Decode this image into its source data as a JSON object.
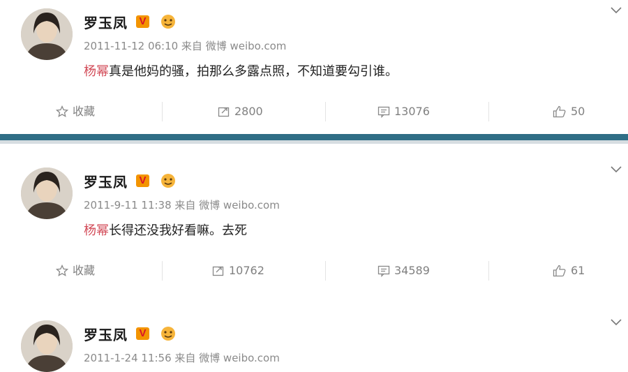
{
  "posts": [
    {
      "username": "罗玉凤",
      "verified_badge": "V",
      "emoji_badge": "smiling-face-icon",
      "meta": "2011-11-12 06:10 来自 微博 weibo.com",
      "mention": "杨幂",
      "text": "真是他妈的骚，拍那么多露点照，不知道要勾引谁。",
      "actions": {
        "favorite": "收藏",
        "repost": "2800",
        "comment": "13076",
        "like": "50"
      }
    },
    {
      "username": "罗玉凤",
      "verified_badge": "V",
      "emoji_badge": "smiling-face-icon",
      "meta": "2011-9-11 11:38 来自 微博 weibo.com",
      "mention": "杨幂",
      "text": "长得还没我好看嘛。去死",
      "actions": {
        "favorite": "收藏",
        "repost": "10762",
        "comment": "34589",
        "like": "61"
      }
    },
    {
      "username": "罗玉凤",
      "verified_badge": "V",
      "emoji_badge": "smiling-face-icon",
      "meta": "2011-1-24 11:56 来自 微博 weibo.com"
    }
  ],
  "colors": {
    "mention": "#d24a57",
    "divider": "#2f6e86",
    "verified": "#f39400"
  }
}
